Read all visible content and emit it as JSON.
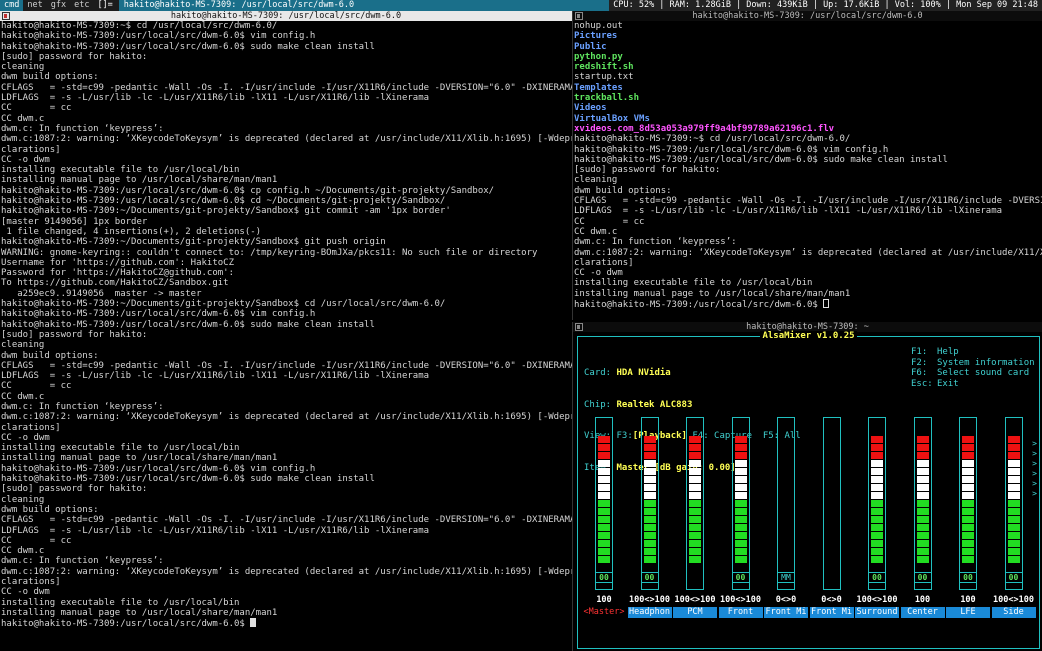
{
  "bar": {
    "tags": [
      "cmd",
      "net",
      "gfx",
      "etc"
    ],
    "layout": "[]=",
    "title": "hakito@hakito-MS-7309: /usr/local/src/dwm-6.0",
    "status": "CPU: 52% | RAM: 1.28GiB | Down: 439KiB | Up: 17.6KiB | Vol: 100% | Mon Sep 09 21:48"
  },
  "win1": {
    "title": "hakito@hakito-MS-7309: /usr/local/src/dwm-6.0",
    "lines": [
      "hakito@hakito-MS-7309:~$ cd /usr/local/src/dwm-6.0/",
      "hakito@hakito-MS-7309:/usr/local/src/dwm-6.0$ vim config.h",
      "hakito@hakito-MS-7309:/usr/local/src/dwm-6.0$ sudo make clean install",
      "[sudo] password for hakito:",
      "cleaning",
      "dwm build options:",
      "CFLAGS   = -std=c99 -pedantic -Wall -Os -I. -I/usr/include -I/usr/X11R6/include -DVERSION=\"6.0\" -DXINERAMA",
      "LDFLAGS  = -s -L/usr/lib -lc -L/usr/X11R6/lib -lX11 -L/usr/X11R6/lib -lXinerama",
      "CC       = cc",
      "CC dwm.c",
      "dwm.c: In function ‘keypress’:",
      "dwm.c:1087:2: warning: ‘XKeycodeToKeysym’ is deprecated (declared at /usr/include/X11/Xlib.h:1695) [-Wdeprecated-de",
      "clarations]",
      "CC -o dwm",
      "installing executable file to /usr/local/bin",
      "installing manual page to /usr/local/share/man/man1",
      "hakito@hakito-MS-7309:/usr/local/src/dwm-6.0$ cp config.h ~/Documents/git-projekty/Sandbox/",
      "hakito@hakito-MS-7309:/usr/local/src/dwm-6.0$ cd ~/Documents/git-projekty/Sandbox/",
      "hakito@hakito-MS-7309:~/Documents/git-projekty/Sandbox$ git commit -am '1px border'",
      "[master 9149056] 1px border",
      " 1 file changed, 4 insertions(+), 2 deletions(-)",
      "hakito@hakito-MS-7309:~/Documents/git-projekty/Sandbox$ git push origin",
      "WARNING: gnome-keyring:: couldn't connect to: /tmp/keyring-BOmJXa/pkcs11: No such file or directory",
      "Username for 'https://github.com': HakitoCZ",
      "Password for 'https://HakitoCZ@github.com':",
      "To https://github.com/HakitoCZ/Sandbox.git",
      "   a259ec9..9149056  master -> master",
      "hakito@hakito-MS-7309:~/Documents/git-projekty/Sandbox$ cd /usr/local/src/dwm-6.0/",
      "hakito@hakito-MS-7309:/usr/local/src/dwm-6.0$ vim config.h",
      "hakito@hakito-MS-7309:/usr/local/src/dwm-6.0$ sudo make clean install",
      "[sudo] password for hakito:",
      "cleaning",
      "dwm build options:",
      "CFLAGS   = -std=c99 -pedantic -Wall -Os -I. -I/usr/include -I/usr/X11R6/include -DVERSION=\"6.0\" -DXINERAMA",
      "LDFLAGS  = -s -L/usr/lib -lc -L/usr/X11R6/lib -lX11 -L/usr/X11R6/lib -lXinerama",
      "CC       = cc",
      "CC dwm.c",
      "dwm.c: In function ‘keypress’:",
      "dwm.c:1087:2: warning: ‘XKeycodeToKeysym’ is deprecated (declared at /usr/include/X11/Xlib.h:1695) [-Wdeprecated-de",
      "clarations]",
      "CC -o dwm",
      "installing executable file to /usr/local/bin",
      "installing manual page to /usr/local/share/man/man1",
      "hakito@hakito-MS-7309:/usr/local/src/dwm-6.0$ vim config.h",
      "hakito@hakito-MS-7309:/usr/local/src/dwm-6.0$ sudo make clean install",
      "[sudo] password for hakito:",
      "cleaning",
      "dwm build options:",
      "CFLAGS   = -std=c99 -pedantic -Wall -Os -I. -I/usr/include -I/usr/X11R6/include -DVERSION=\"6.0\" -DXINERAMA",
      "LDFLAGS  = -s -L/usr/lib -lc -L/usr/X11R6/lib -lX11 -L/usr/X11R6/lib -lXinerama",
      "CC       = cc",
      "CC dwm.c",
      "dwm.c: In function ‘keypress’:",
      "dwm.c:1087:2: warning: ‘XKeycodeToKeysym’ is deprecated (declared at /usr/include/X11/Xlib.h:1695) [-Wdeprecated-de",
      "clarations]",
      "CC -o dwm",
      "installing executable file to /usr/local/bin",
      "installing manual page to /usr/local/share/man/man1",
      "hakito@hakito-MS-7309:/usr/local/src/dwm-6.0$ "
    ]
  },
  "win2": {
    "title": "hakito@hakito-MS-7309: /usr/local/src/dwm-6.0",
    "lines": [
      {
        "t": "nohup.out",
        "c": "n"
      },
      {
        "t": "Pictures",
        "c": "d"
      },
      {
        "t": "Public",
        "c": "d"
      },
      {
        "t": "python.py",
        "c": "x"
      },
      {
        "t": "redshift.sh",
        "c": "x"
      },
      {
        "t": "startup.txt",
        "c": "n"
      },
      {
        "t": "Templates",
        "c": "d"
      },
      {
        "t": "trackball.sh",
        "c": "x"
      },
      {
        "t": "Videos",
        "c": "d"
      },
      {
        "t": "VirtualBox VMs",
        "c": "d"
      },
      {
        "t": "xvideos.com_8d53a053a979ff9a4bf99789a62196c1.flv",
        "c": "m"
      },
      {
        "t": "hakito@hakito-MS-7309:~$ cd /usr/local/src/dwm-6.0/",
        "c": "n"
      },
      {
        "t": "hakito@hakito-MS-7309:/usr/local/src/dwm-6.0$ vim config.h",
        "c": "n"
      },
      {
        "t": "hakito@hakito-MS-7309:/usr/local/src/dwm-6.0$ sudo make clean install",
        "c": "n"
      },
      {
        "t": "[sudo] password for hakito:",
        "c": "n"
      },
      {
        "t": "cleaning",
        "c": "n"
      },
      {
        "t": "dwm build options:",
        "c": "n"
      },
      {
        "t": "CFLAGS   = -std=c99 -pedantic -Wall -Os -I. -I/usr/include -I/usr/X11R6/include -DVERSION=\"6.0",
        "c": "n"
      },
      {
        "t": "LDFLAGS  = -s -L/usr/lib -lc -L/usr/X11R6/lib -lX11 -L/usr/X11R6/lib -lXinerama",
        "c": "n"
      },
      {
        "t": "CC       = cc",
        "c": "n"
      },
      {
        "t": "CC dwm.c",
        "c": "n"
      },
      {
        "t": "dwm.c: In function ‘keypress’:",
        "c": "n"
      },
      {
        "t": "dwm.c:1087:2: warning: ‘XKeycodeToKeysym’ is deprecated (declared at /usr/include/X11/Xlib.h:1",
        "c": "n"
      },
      {
        "t": "clarations]",
        "c": "n"
      },
      {
        "t": "CC -o dwm",
        "c": "n"
      },
      {
        "t": "installing executable file to /usr/local/bin",
        "c": "n"
      },
      {
        "t": "installing manual page to /usr/local/share/man/man1",
        "c": "n"
      },
      {
        "t": "hakito@hakito-MS-7309:/usr/local/src/dwm-6.0$ ",
        "c": "n"
      }
    ]
  },
  "win3": {
    "title": "hakito@hakito-MS-7309: ~",
    "app_title": "AlsaMixer v1.0.25",
    "info": {
      "card_label": "Card:",
      "card": "HDA NVidia",
      "chip_label": "Chip:",
      "chip": "Realtek ALC883",
      "view_label": "View:",
      "view_f3": "F3:",
      "view_active": "[Playback]",
      "view_rest": " F4: Capture  F5: All",
      "item_label": "Item:",
      "item": "Master [dB gain: 0.00]"
    },
    "help": [
      {
        "key": "F1:",
        "text": "Help"
      },
      {
        "key": "F2:",
        "text": "System information"
      },
      {
        "key": "F6:",
        "text": "Select sound card"
      },
      {
        "key": "Esc:",
        "text": "Exit"
      }
    ],
    "scroll_arrow": ">",
    "channels": [
      {
        "name": "Master",
        "volume": "100",
        "level": 1.0,
        "mute": "00",
        "has_gauge": true,
        "selected": true
      },
      {
        "name": "Headphon",
        "volume": "100<>100",
        "level": 1.0,
        "mute": "00",
        "has_gauge": true,
        "selected": false
      },
      {
        "name": "PCM",
        "volume": "100<>100",
        "level": 1.0,
        "mute": "",
        "has_gauge": true,
        "selected": false
      },
      {
        "name": "Front",
        "volume": "100<>100",
        "level": 1.0,
        "mute": "00",
        "has_gauge": true,
        "selected": false
      },
      {
        "name": "Front Mi",
        "volume": "0<>0",
        "level": 0,
        "mute": "MM",
        "has_gauge": true,
        "selected": false
      },
      {
        "name": "Front Mi",
        "volume": "0<>0",
        "level": 0,
        "mute": "",
        "has_gauge": true,
        "selected": false
      },
      {
        "name": "Surround",
        "volume": "100<>100",
        "level": 1.0,
        "mute": "00",
        "has_gauge": true,
        "selected": false
      },
      {
        "name": "Center",
        "volume": "100",
        "level": 1.0,
        "mute": "00",
        "has_gauge": true,
        "selected": false
      },
      {
        "name": "LFE",
        "volume": "100",
        "level": 1.0,
        "mute": "00",
        "has_gauge": true,
        "selected": false
      },
      {
        "name": "Side",
        "volume": "100<>100",
        "level": 1.0,
        "mute": "00",
        "has_gauge": true,
        "selected": false
      }
    ]
  },
  "colors": {
    "accent": "#1a6f8a",
    "cyan": "#20c0c0",
    "yellow": "#ffff55",
    "green": "#22dd22",
    "red": "#ee1111"
  }
}
